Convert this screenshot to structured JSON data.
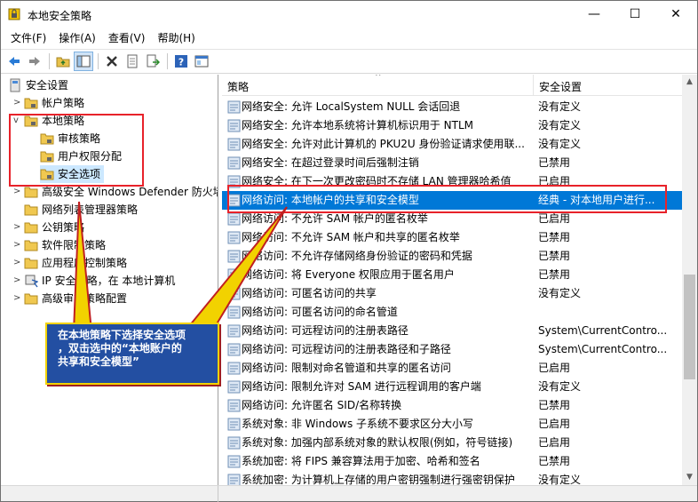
{
  "window": {
    "title": "本地安全策略",
    "minimize": "—",
    "maximize": "☐",
    "close": "✕"
  },
  "menu": [
    "文件(F)",
    "操作(A)",
    "查看(V)",
    "帮助(H)"
  ],
  "toolbar_icons": [
    "back-arrow-icon",
    "forward-arrow-icon",
    "up-folder-icon",
    "show-tree-icon",
    "delete-icon",
    "properties-icon",
    "export-list-icon",
    "help-icon",
    "console-icon"
  ],
  "tree": {
    "root": "安全设置",
    "account_policies": "帐户策略",
    "local_policies": "本地策略",
    "audit_policy": "审核策略",
    "user_rights": "用户权限分配",
    "security_options": "安全选项",
    "defender_firewall": "高级安全 Windows Defender 防火墙",
    "network_list": "网络列表管理器策略",
    "public_key": "公钥策略",
    "software_restriction": "软件限制策略",
    "app_control": "应用程序控制策略",
    "ipsec": "IP 安全策略，在 本地计算机",
    "audit_config": "高级审核策略配置"
  },
  "columns": {
    "policy": "策略",
    "setting": "安全设置"
  },
  "rows": [
    {
      "policy": "网络安全: 允许 LocalSystem NULL 会话回退",
      "setting": "没有定义"
    },
    {
      "policy": "网络安全: 允许本地系统将计算机标识用于 NTLM",
      "setting": "没有定义"
    },
    {
      "policy": "网络安全: 允许对此计算机的 PKU2U 身份验证请求使用联...",
      "setting": "没有定义"
    },
    {
      "policy": "网络安全: 在超过登录时间后强制注销",
      "setting": "已禁用"
    },
    {
      "policy": "网络安全: 在下一次更改密码时不存储 LAN 管理器哈希值",
      "setting": "已启用"
    },
    {
      "policy": "网络访问: 本地帐户的共享和安全模型",
      "setting": "经典 - 对本地用户进行..."
    },
    {
      "policy": "网络访问: 不允许 SAM 帐户的匿名枚举",
      "setting": "已启用"
    },
    {
      "policy": "网络访问: 不允许 SAM 帐户和共享的匿名枚举",
      "setting": "已禁用"
    },
    {
      "policy": "网络访问: 不允许存储网络身份验证的密码和凭据",
      "setting": "已禁用"
    },
    {
      "policy": "网络访问: 将 Everyone 权限应用于匿名用户",
      "setting": "已禁用"
    },
    {
      "policy": "网络访问: 可匿名访问的共享",
      "setting": "没有定义"
    },
    {
      "policy": "网络访问: 可匿名访问的命名管道",
      "setting": ""
    },
    {
      "policy": "网络访问: 可远程访问的注册表路径",
      "setting": "System\\CurrentContro..."
    },
    {
      "policy": "网络访问: 可远程访问的注册表路径和子路径",
      "setting": "System\\CurrentContro..."
    },
    {
      "policy": "网络访问: 限制对命名管道和共享的匿名访问",
      "setting": "已启用"
    },
    {
      "policy": "网络访问: 限制允许对 SAM 进行远程调用的客户端",
      "setting": "没有定义"
    },
    {
      "policy": "网络访问: 允许匿名 SID/名称转换",
      "setting": "已禁用"
    },
    {
      "policy": "系统对象: 非 Windows 子系统不要求区分大小写",
      "setting": "已启用"
    },
    {
      "policy": "系统对象: 加强内部系统对象的默认权限(例如，符号链接)",
      "setting": "已启用"
    },
    {
      "policy": "系统加密: 将 FIPS 兼容算法用于加密、哈希和签名",
      "setting": "已禁用"
    },
    {
      "policy": "系统加密: 为计算机上存储的用户密钥强制进行强密钥保护",
      "setting": "没有定义"
    }
  ],
  "selected_row": 5,
  "callout_lines": [
    "在本地策略下选择安全选项",
    "，双击选中的“本地账户的",
    "共享和安全模型”"
  ],
  "colors": {
    "selection": "#0078d7",
    "annotation_red": "#e8222a",
    "callout_bg": "#234fa2",
    "callout_border": "#f2d200"
  }
}
